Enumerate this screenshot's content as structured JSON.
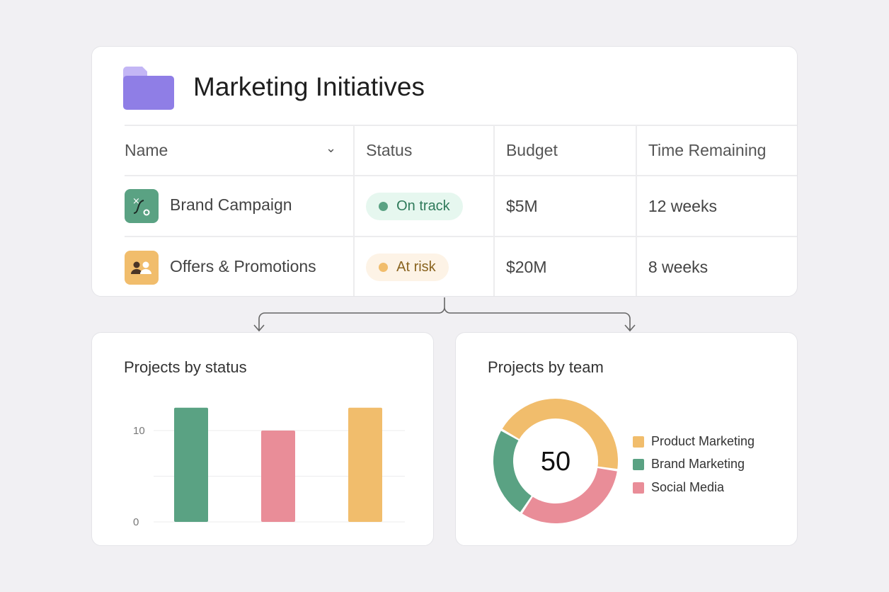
{
  "header": {
    "title": "Marketing Initiatives",
    "icon": "folder-icon"
  },
  "table": {
    "columns": [
      "Name",
      "Status",
      "Budget",
      "Time Remaining"
    ],
    "rows": [
      {
        "name": "Brand Campaign",
        "icon": "strategy-icon",
        "status": "On track",
        "budget": "$5M",
        "time": "12 weeks"
      },
      {
        "name": "Offers & Promotions",
        "icon": "users-icon",
        "status": "At risk",
        "budget": "$20M",
        "time": "8 weeks"
      }
    ]
  },
  "colors": {
    "green": "#5aa283",
    "pink": "#e98d98",
    "orange": "#f1bd6c",
    "ontrack_bg": "#e6f7ef",
    "atrisk_bg": "#fdf3e6"
  },
  "chart_data": [
    {
      "type": "bar",
      "title": "Projects by status",
      "categories": [
        "",
        "",
        ""
      ],
      "values": [
        12.5,
        10,
        12.5
      ],
      "colors": [
        "#5aa283",
        "#e98d98",
        "#f1bd6c"
      ],
      "yticks": [
        "0",
        "10"
      ],
      "ylim": [
        0,
        10
      ],
      "grid": true
    },
    {
      "type": "pie",
      "title": "Projects by team",
      "center_label": "50",
      "labels": [
        "Product Marketing",
        "Brand Marketing",
        "Social Media"
      ],
      "values": [
        22,
        12,
        16
      ],
      "colors": [
        "#f1bd6c",
        "#5aa283",
        "#e98d98"
      ],
      "legend": "right"
    }
  ]
}
